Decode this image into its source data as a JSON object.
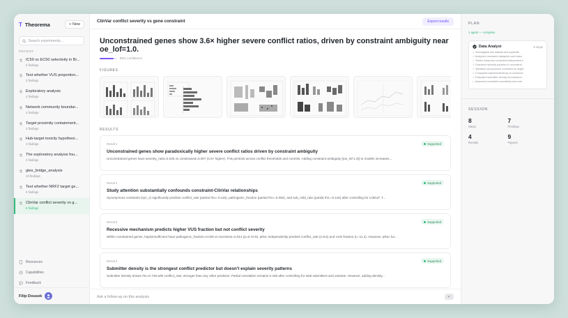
{
  "sidebar": {
    "brand": "Theorema",
    "new_label": "+ New",
    "search_placeholder": "Search experiments...",
    "recent_label": "RECENT",
    "items": [
      {
        "title": "IC50 vs EC50 selectivity in Bi...",
        "sub": "5 findings"
      },
      {
        "title": "Test whether VUS proportion...",
        "sub": "3 findings"
      },
      {
        "title": "Exploratory analysis",
        "sub": "4 findings"
      },
      {
        "title": "Network community boundar...",
        "sub": "4 findings"
      },
      {
        "title": "Target proximity containment...",
        "sub": "4 findings"
      },
      {
        "title": "Hub-target toxicity hypothesi...",
        "sub": "3 findings"
      },
      {
        "title": "The exploratory analysis fou...",
        "sub": "4 findings"
      },
      {
        "title": "gtex_bridge_analysis",
        "sub": "10 findings"
      },
      {
        "title": "Test whether NRF2 target ge...",
        "sub": "5 findings"
      },
      {
        "title": "ClinVar conflict severity vs g...",
        "sub": "6 findings"
      }
    ],
    "links": [
      "Resources",
      "Capabilities",
      "Feedback"
    ],
    "user": "Filip Dousek"
  },
  "main": {
    "title": "ClinVar conflict severity vs gene constraint",
    "export_label": "Export results",
    "headline": "Unconstrained genes show 3.6× higher severe conflict ratios, driven by constraint ambiguity near oe_lof=1.0.",
    "confidence_text": "85% confidence",
    "confidence_value": 0.85,
    "figures_label": "FIGURES",
    "results_label": "RESULTS",
    "results": [
      {
        "num": "Result 1",
        "status": "Supported",
        "title": "Unconstrained genes show paradoxically higher severe conflict ratios driven by constraint ambiguity",
        "desc": "Unconstrained genes have severity_ratio=0.025 vs constrained=0.007 (3.6× higher). This persists across conflict thresholds and controls. Adding constraint ambiguity (|oe_lof-1.0|) to models increases..."
      },
      {
        "num": "Result 2",
        "status": "Supported",
        "title": "Study attention substantially confounds constraint-ClinVar relationships",
        "desc": "Synonymous constraint (syn_z) significantly predicts conflict_rate (partial rho=-0.116), pathogenic_fraction (partial rho=-0.092), and sub_mild_rate (partial rho=-0.116) after controlling for LOEUF. T..."
      },
      {
        "num": "Result 3",
        "status": "Supported",
        "title": "Recessive mechanism predicts higher VUS fraction but not conflict severity",
        "desc": "Within constrained genes, haploinsufficient have pathogenic_fraction=0.026 vs recessive=0.014 (p=6.7e-8). pRec independently predicts conflict_rate (t=9.6) and VUS fraction (t=-11.2). However, pRec ha..."
      },
      {
        "num": "Result 4",
        "status": "Supported",
        "title": "Submitter density is the strongest conflict predictor but doesn't explain severity patterns",
        "desc": "Submitter density shows rho=0.749 with conflict_rate, stronger than any other predictor. Partial correlation remains 0.436 after controlling for total submitters and variants. However, adding density..."
      }
    ],
    "followup_placeholder": "Ask a follow-up on this analysis",
    "send_icon": "↵"
  },
  "plan": {
    "label": "PLAN",
    "status": "1 agent — complete",
    "agent_name": "Data Analyst",
    "agent_steps": "8 steps",
    "steps": [
      "✓ Investigated raw dataset and duplicate",
      "✓ Analyzed constraint categories and class",
      "✓ Tested missense constraint independent e",
      "✓ Examined severity paradox in unconstrai",
      "✓ Validated synonymous constraint as negat",
      "✓ Compared haploinsufficiency vs recessive",
      "✓ Evaluated submitter density as independ",
      "✓ Assessed constraint uncertainty and conf"
    ]
  },
  "session": {
    "label": "SESSION",
    "stats": [
      {
        "value": "8",
        "label": "Steps"
      },
      {
        "value": "7",
        "label": "Findings"
      },
      {
        "value": "4",
        "label": "Results"
      },
      {
        "value": "9",
        "label": "Figures"
      }
    ]
  },
  "colors": {
    "accent": "#6d4aff",
    "success": "#34b87a"
  }
}
